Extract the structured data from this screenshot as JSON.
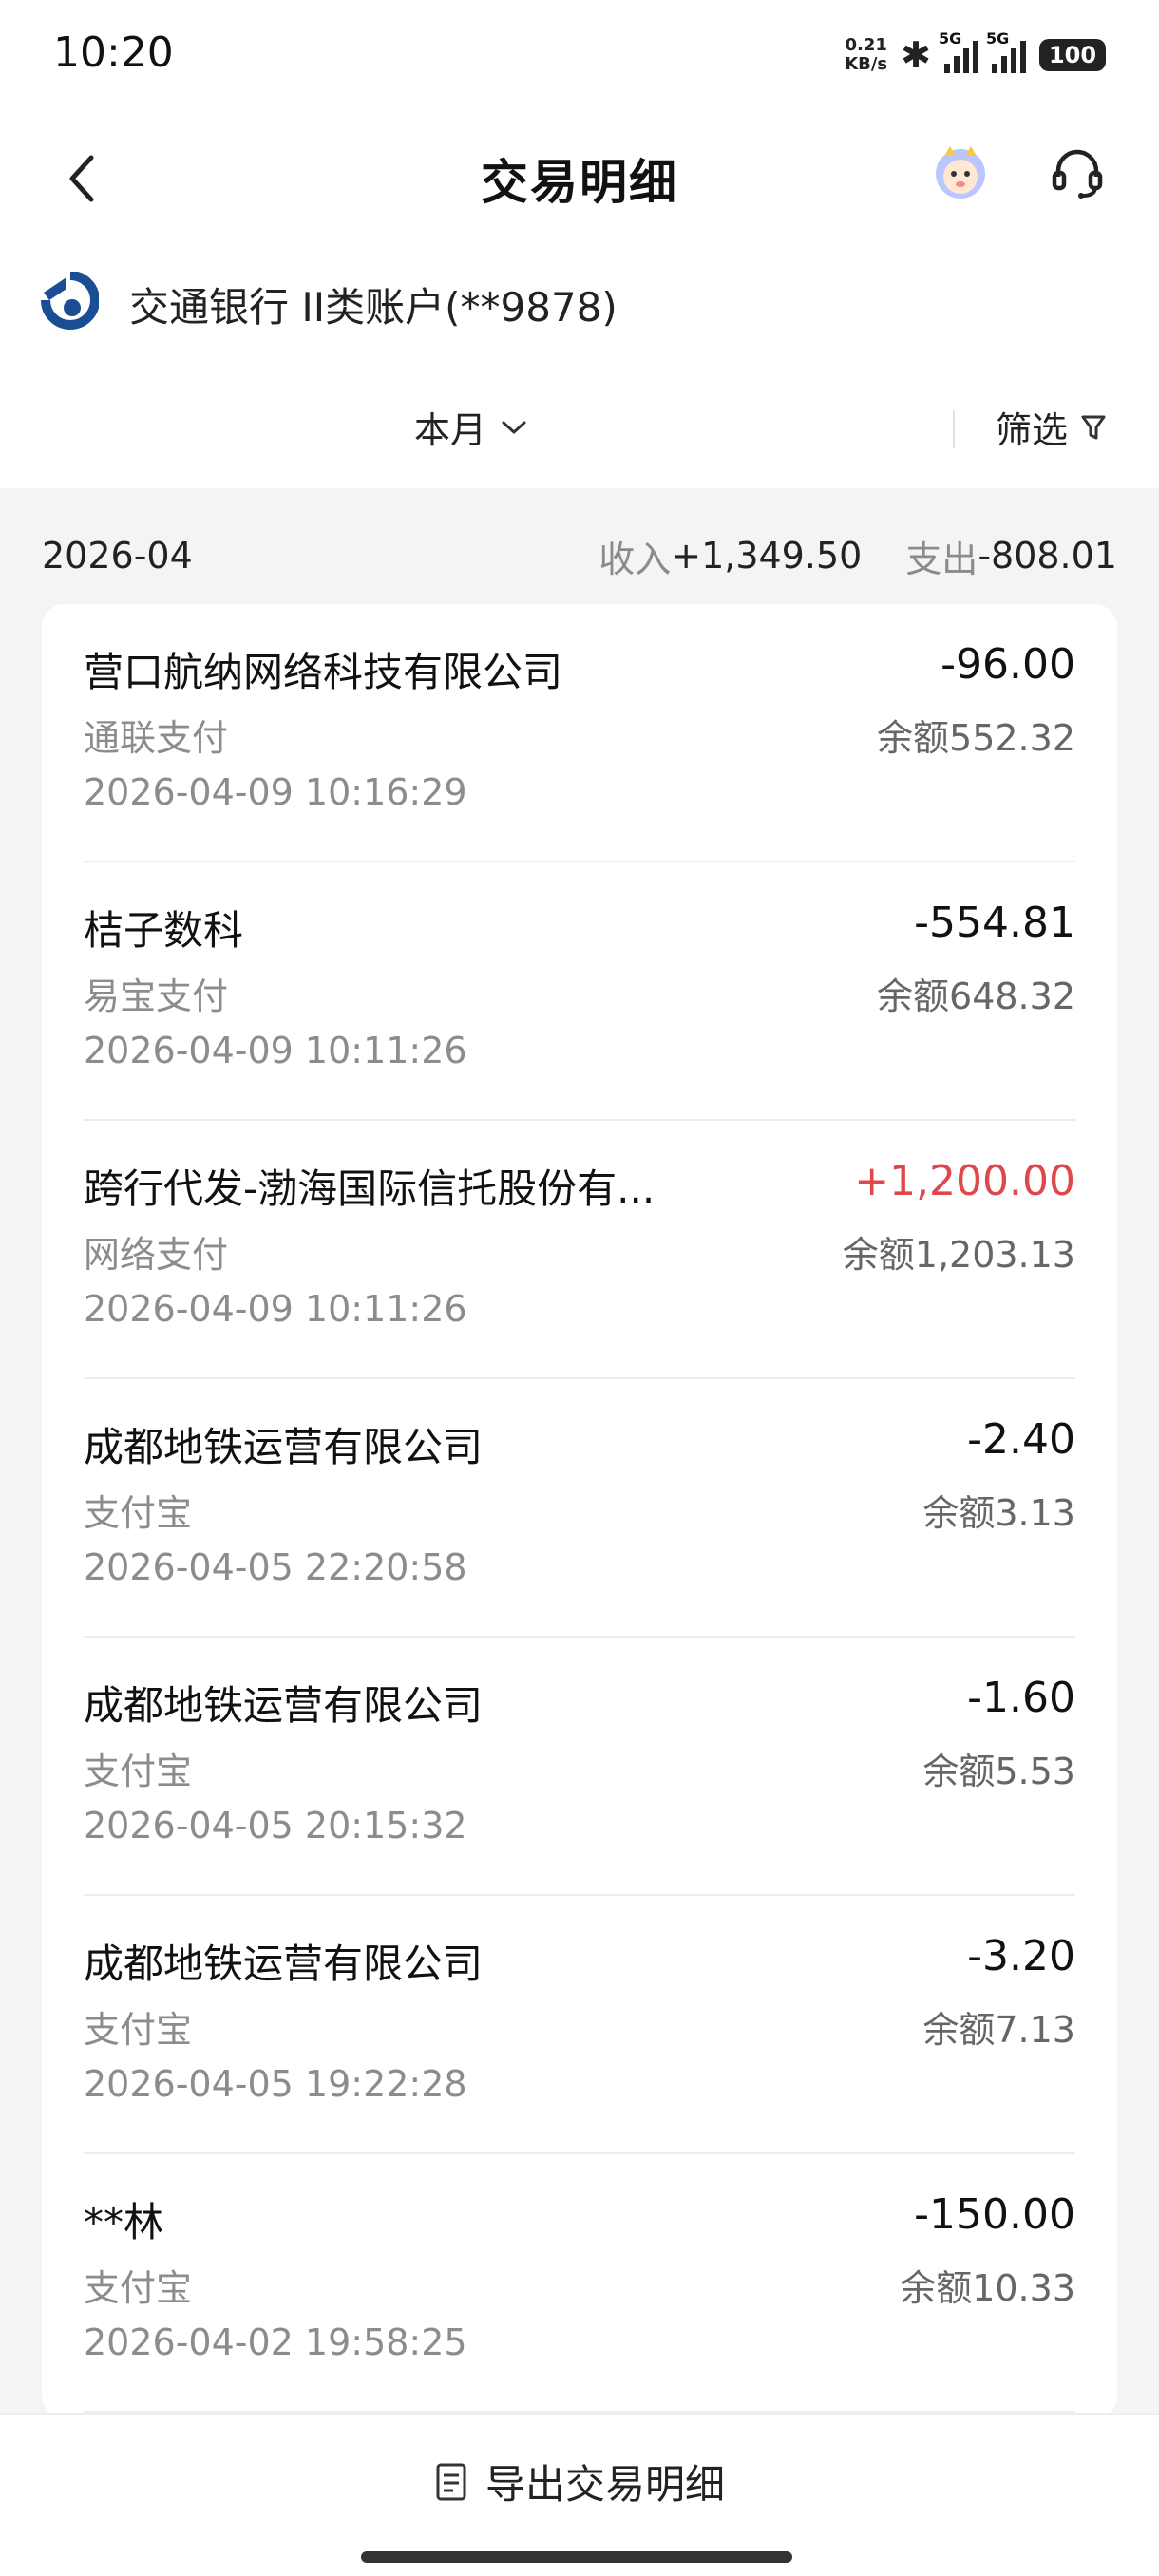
{
  "status_bar": {
    "time": "10:20",
    "net_speed_value": "0.21",
    "net_speed_unit": "KB/s",
    "signal_1": "5G",
    "signal_2": "5G",
    "battery": "100"
  },
  "header": {
    "title": "交易明细",
    "icons": [
      "back-icon",
      "mascot-icon",
      "customer-service-icon"
    ]
  },
  "account": {
    "name": "交通银行 II类账户(**9878)",
    "logo_color": "#1a4d94"
  },
  "filter": {
    "period": "本月",
    "filter_label": "筛选"
  },
  "summary": {
    "month": "2026-04",
    "income_key": "收入",
    "income_value": "+1,349.50",
    "expense_key": "支出",
    "expense_value": "-808.01"
  },
  "transactions": [
    {
      "title": "营口航纳网络科技有限公司",
      "channel": "通联支付",
      "time": "2026-04-09 10:16:29",
      "amount": "-96.00",
      "balance": "余额552.32"
    },
    {
      "title": "桔子数科",
      "channel": "易宝支付",
      "time": "2026-04-09 10:11:26",
      "amount": "-554.81",
      "balance": "余额648.32"
    },
    {
      "title": "跨行代发-渤海国际信托股份有...",
      "channel": "网络支付",
      "time": "2026-04-09 10:11:26",
      "amount": "+1,200.00",
      "balance": "余额1,203.13"
    },
    {
      "title": "成都地铁运营有限公司",
      "channel": "支付宝",
      "time": "2026-04-05 22:20:58",
      "amount": "-2.40",
      "balance": "余额3.13"
    },
    {
      "title": "成都地铁运营有限公司",
      "channel": "支付宝",
      "time": "2026-04-05 20:15:32",
      "amount": "-1.60",
      "balance": "余额5.53"
    },
    {
      "title": "成都地铁运营有限公司",
      "channel": "支付宝",
      "time": "2026-04-05 19:22:28",
      "amount": "-3.20",
      "balance": "余额7.13"
    },
    {
      "title": "**林",
      "channel": "支付宝",
      "time": "2026-04-02 19:58:25",
      "amount": "-150.00",
      "balance": "余额10.33"
    }
  ],
  "bottom": {
    "export_label": "导出交易明细"
  },
  "colors": {
    "income": "#e0474c",
    "accent_blue": "#1a4d94",
    "background": "#f4f4f4"
  }
}
